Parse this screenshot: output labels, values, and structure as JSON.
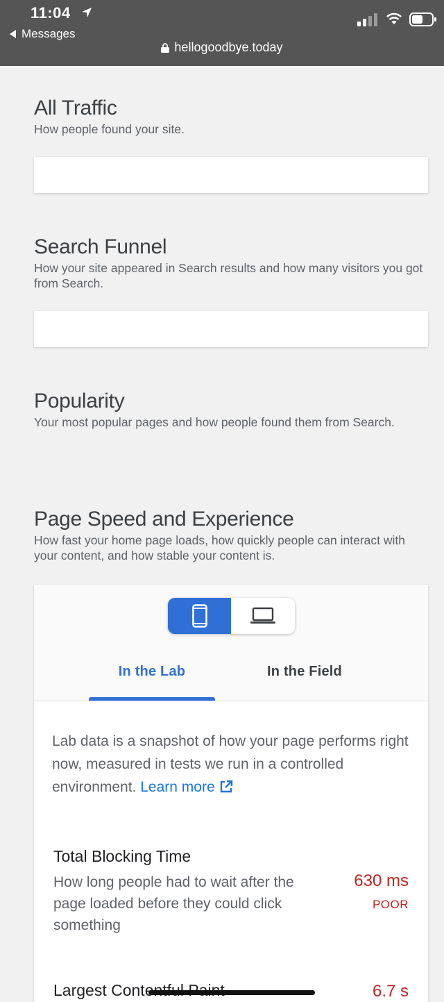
{
  "status_bar": {
    "time": "11:04",
    "back_label": "Messages",
    "url": "hellogoodbye.today",
    "icons": [
      "location-arrow-icon",
      "back-triangle-icon",
      "signal-icon",
      "wifi-icon",
      "battery-icon",
      "lock-icon"
    ]
  },
  "sections": {
    "all_traffic": {
      "title": "All Traffic",
      "subtitle": "How people found your site."
    },
    "search_funnel": {
      "title": "Search Funnel",
      "subtitle": "How your site appeared in Search results and how many visitors you got from Search."
    },
    "popularity": {
      "title": "Popularity",
      "subtitle": "Your most popular pages and how people found them from Search."
    },
    "page_speed": {
      "title": "Page Speed and Experience",
      "subtitle": "How fast your home page loads, how quickly people can interact with your content, and how stable your content is."
    }
  },
  "speed_card": {
    "device_toggle": {
      "selected": "mobile",
      "icons": [
        "phone-icon",
        "laptop-icon"
      ]
    },
    "tabs": [
      {
        "label": "In the Lab",
        "active": true
      },
      {
        "label": "In the Field",
        "active": false
      }
    ],
    "lab_description": "Lab data is a snapshot of how your page performs right now, measured in tests we run in a controlled environment.",
    "learn_more": "Learn more",
    "metrics": [
      {
        "title": "Total Blocking Time",
        "description": "How long people had to wait after the page loaded before they could click something",
        "value": "630 ms",
        "rating": "POOR"
      },
      {
        "title": "Largest Contentful Paint",
        "value": "6.7 s"
      }
    ]
  },
  "colors": {
    "status_bar_bg": "#555555",
    "page_bg": "#f1f1f2",
    "accent_blue": "#2f6fd6",
    "poor_red": "#c5221f"
  }
}
